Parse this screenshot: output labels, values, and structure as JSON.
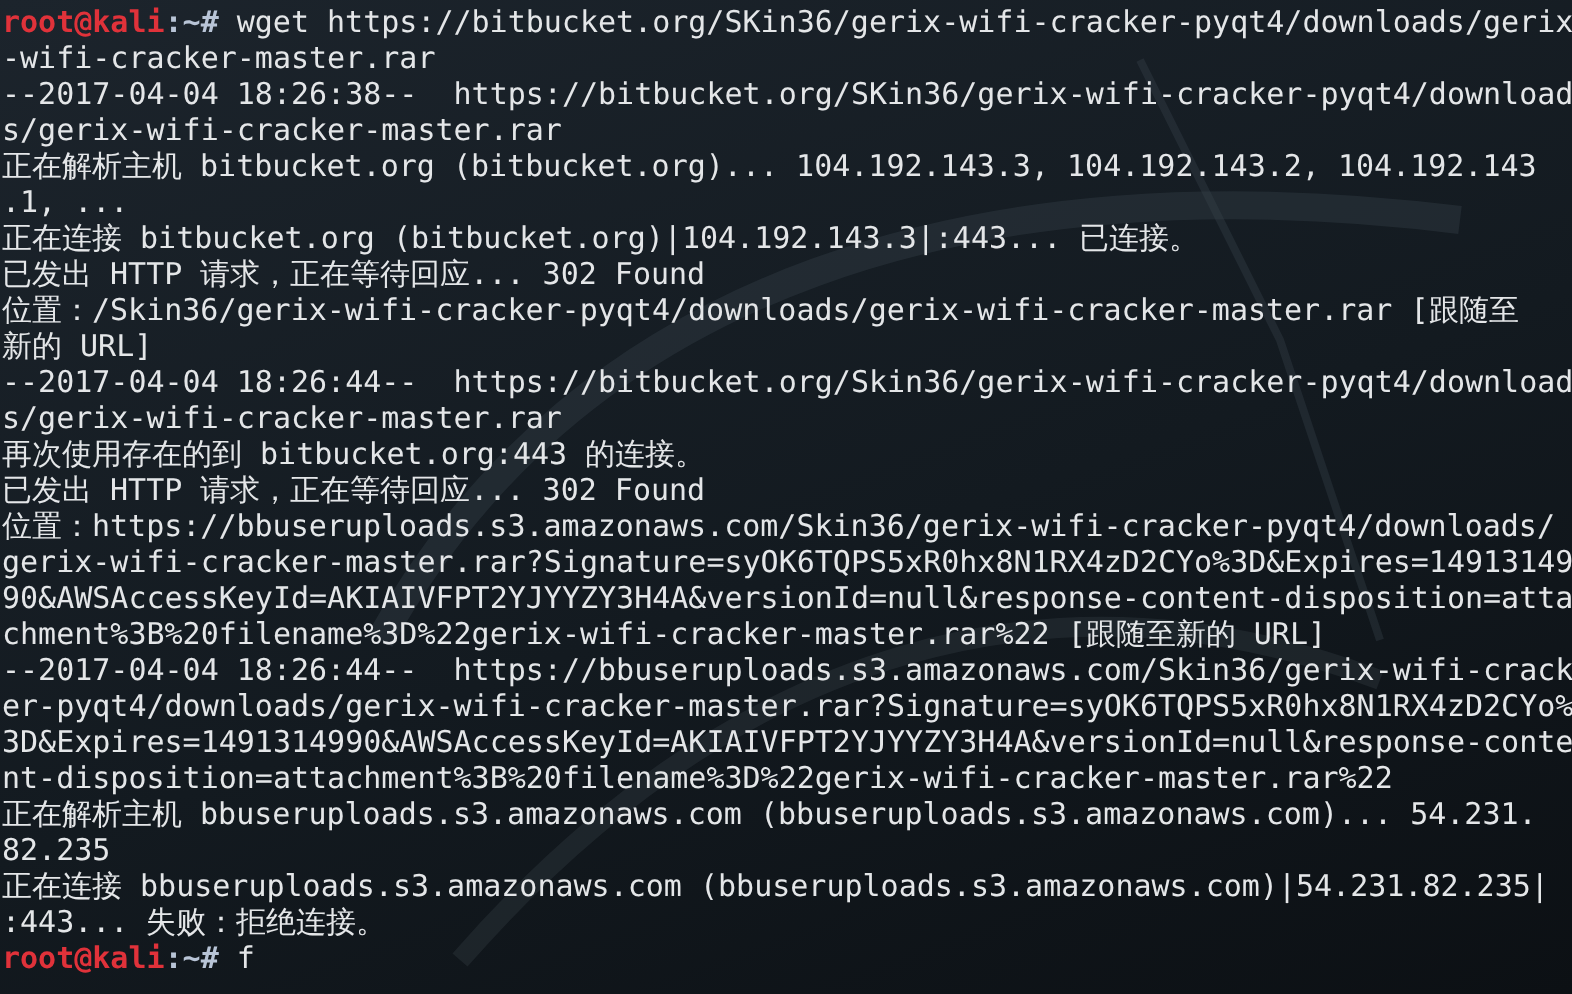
{
  "terminal": {
    "lines": [
      {
        "kind": "prompt",
        "user": "root@kali",
        "path": ":~#",
        "command": "wget https://bitbucket.org/SKin36/gerix-wifi-cracker-pyqt4/downloads/gerix"
      },
      {
        "kind": "output",
        "text": "-wifi-cracker-master.rar"
      },
      {
        "kind": "output",
        "text": "--2017-04-04 18:26:38--  https://bitbucket.org/SKin36/gerix-wifi-cracker-pyqt4/download"
      },
      {
        "kind": "output",
        "text": "s/gerix-wifi-cracker-master.rar"
      },
      {
        "kind": "output",
        "text": "正在解析主机 bitbucket.org (bitbucket.org)... 104.192.143.3, 104.192.143.2, 104.192.143"
      },
      {
        "kind": "output",
        "text": ".1, ..."
      },
      {
        "kind": "output",
        "text": "正在连接 bitbucket.org (bitbucket.org)|104.192.143.3|:443... 已连接。"
      },
      {
        "kind": "output",
        "text": "已发出 HTTP 请求，正在等待回应... 302 Found"
      },
      {
        "kind": "output",
        "text": "位置：/Skin36/gerix-wifi-cracker-pyqt4/downloads/gerix-wifi-cracker-master.rar [跟随至"
      },
      {
        "kind": "output",
        "text": "新的 URL]"
      },
      {
        "kind": "output",
        "text": "--2017-04-04 18:26:44--  https://bitbucket.org/Skin36/gerix-wifi-cracker-pyqt4/download"
      },
      {
        "kind": "output",
        "text": "s/gerix-wifi-cracker-master.rar"
      },
      {
        "kind": "output",
        "text": "再次使用存在的到 bitbucket.org:443 的连接。"
      },
      {
        "kind": "output",
        "text": "已发出 HTTP 请求，正在等待回应... 302 Found"
      },
      {
        "kind": "output",
        "text": "位置：https://bbuseruploads.s3.amazonaws.com/Skin36/gerix-wifi-cracker-pyqt4/downloads/"
      },
      {
        "kind": "output",
        "text": "gerix-wifi-cracker-master.rar?Signature=syOK6TQPS5xR0hx8N1RX4zD2CYo%3D&Expires=14913149"
      },
      {
        "kind": "output",
        "text": "90&AWSAccessKeyId=AKIAIVFPT2YJYYZY3H4A&versionId=null&response-content-disposition=atta"
      },
      {
        "kind": "output",
        "text": "chment%3B%20filename%3D%22gerix-wifi-cracker-master.rar%22 [跟随至新的 URL]"
      },
      {
        "kind": "output",
        "text": "--2017-04-04 18:26:44--  https://bbuseruploads.s3.amazonaws.com/Skin36/gerix-wifi-crack"
      },
      {
        "kind": "output",
        "text": "er-pyqt4/downloads/gerix-wifi-cracker-master.rar?Signature=syOK6TQPS5xR0hx8N1RX4zD2CYo%"
      },
      {
        "kind": "output",
        "text": "3D&Expires=1491314990&AWSAccessKeyId=AKIAIVFPT2YJYYZY3H4A&versionId=null&response-conte"
      },
      {
        "kind": "output",
        "text": "nt-disposition=attachment%3B%20filename%3D%22gerix-wifi-cracker-master.rar%22"
      },
      {
        "kind": "output",
        "text": "正在解析主机 bbuseruploads.s3.amazonaws.com (bbuseruploads.s3.amazonaws.com)... 54.231."
      },
      {
        "kind": "output",
        "text": "82.235"
      },
      {
        "kind": "output",
        "text": "正在连接 bbuseruploads.s3.amazonaws.com (bbuseruploads.s3.amazonaws.com)|54.231.82.235|"
      },
      {
        "kind": "output",
        "text": ":443... 失败：拒绝连接。"
      },
      {
        "kind": "prompt",
        "user": "root@kali",
        "path": ":~#",
        "command": "f"
      }
    ]
  }
}
